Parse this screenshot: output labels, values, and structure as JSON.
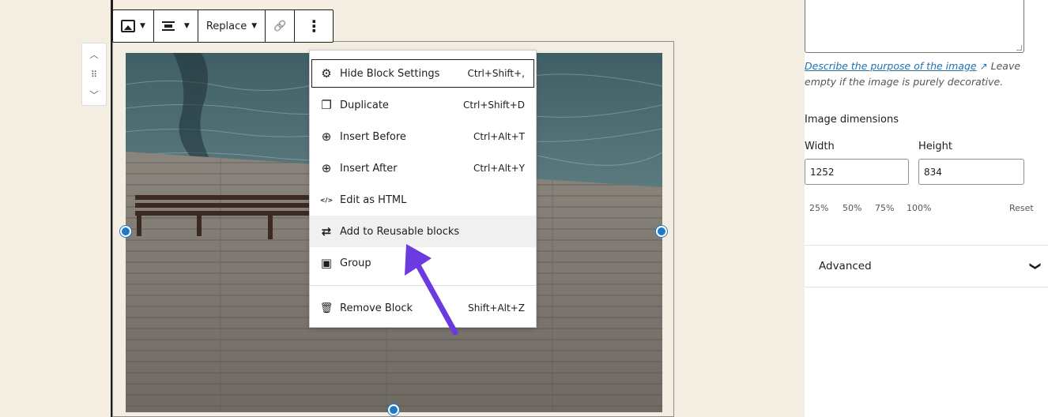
{
  "toolbar": {
    "replace_label": "Replace",
    "caret": "▼",
    "link_icon": "🔗",
    "more_icon": "⋮"
  },
  "mover": {
    "up": "︿",
    "drag": "⠿",
    "down": "﹀"
  },
  "menu": {
    "items": [
      {
        "label": "Hide Block Settings",
        "shortcut": "Ctrl+Shift+,",
        "icon": "gear-icon",
        "glyph": "⚙"
      },
      {
        "label": "Duplicate",
        "shortcut": "Ctrl+Shift+D",
        "icon": "duplicate-icon",
        "glyph": "❐"
      },
      {
        "label": "Insert Before",
        "shortcut": "Ctrl+Alt+T",
        "icon": "insert-before-icon",
        "glyph": "⊕"
      },
      {
        "label": "Insert After",
        "shortcut": "Ctrl+Alt+Y",
        "icon": "insert-after-icon",
        "glyph": "⊕"
      },
      {
        "label": "Edit as HTML",
        "shortcut": "",
        "icon": "html-icon",
        "glyph": "</>"
      },
      {
        "label": "Add to Reusable blocks",
        "shortcut": "",
        "icon": "reusable-icon",
        "glyph": "⇄"
      },
      {
        "label": "Group",
        "shortcut": "",
        "icon": "group-icon",
        "glyph": "▣"
      },
      {
        "label": "Remove Block",
        "shortcut": "Shift+Alt+Z",
        "icon": "trash-icon",
        "glyph": "🗑"
      }
    ]
  },
  "sidebar": {
    "alt_help_link": "Describe the purpose of the image",
    "alt_help_rest": "Leave empty if the image is purely decorative.",
    "external_icon": "↗",
    "dimensions_title": "Image dimensions",
    "width_label": "Width",
    "height_label": "Height",
    "width_value": "1252",
    "height_value": "834",
    "percent_options": [
      "25%",
      "50%",
      "75%",
      "100%"
    ],
    "reset_label": "Reset",
    "advanced_label": "Advanced",
    "chevron": "❯"
  },
  "colors": {
    "accent": "#1f7ac5",
    "annotation_arrow": "#6b3be0",
    "link": "#2271b1"
  }
}
